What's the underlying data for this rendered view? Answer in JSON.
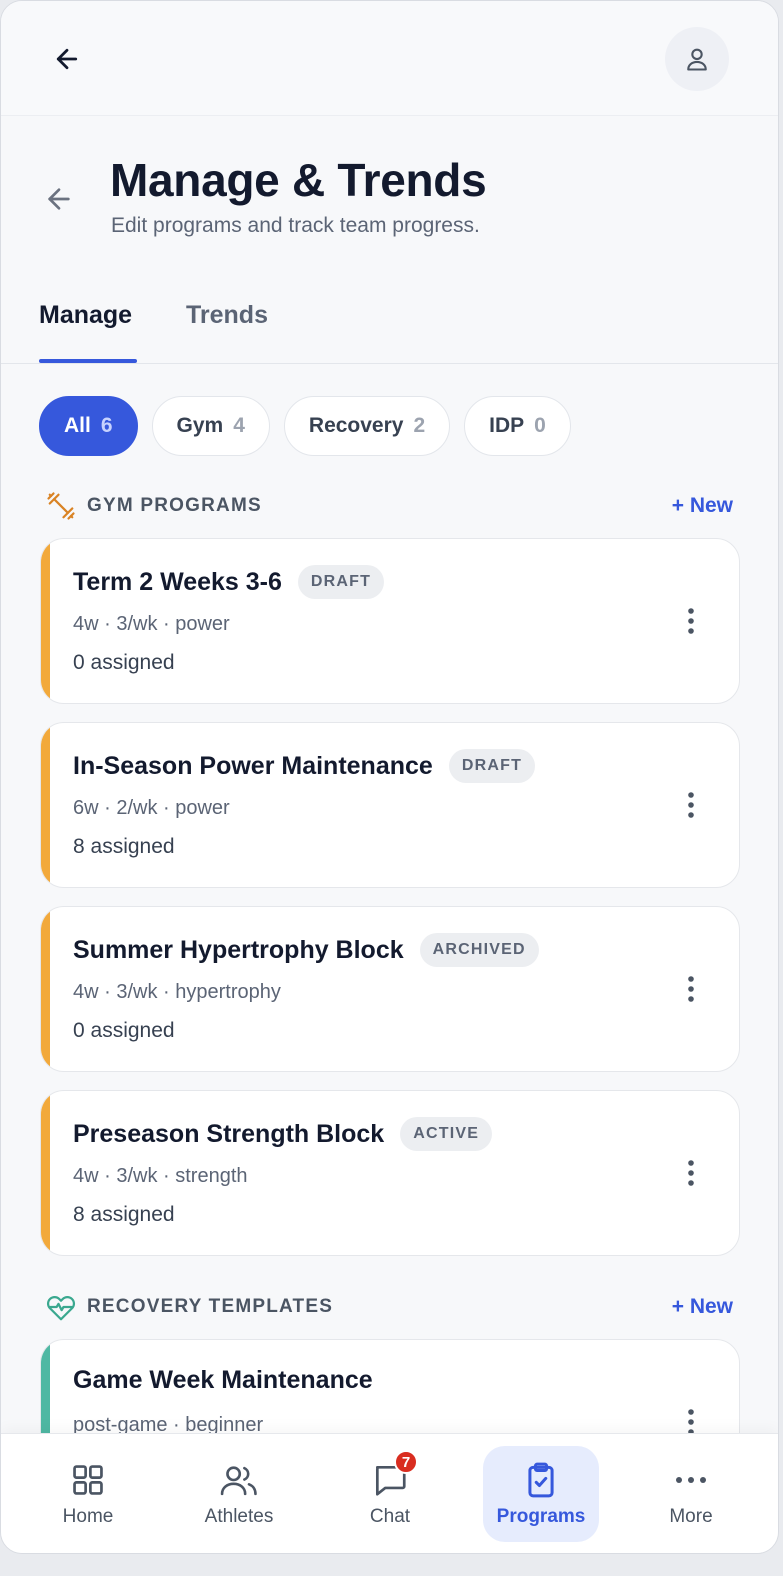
{
  "header": {
    "title": "Manage & Trends",
    "subtitle": "Edit programs and track team progress."
  },
  "tabs": [
    {
      "label": "Manage",
      "active": true
    },
    {
      "label": "Trends",
      "active": false
    }
  ],
  "filters": [
    {
      "label": "All",
      "count": "6",
      "active": true
    },
    {
      "label": "Gym",
      "count": "4",
      "active": false
    },
    {
      "label": "Recovery",
      "count": "2",
      "active": false
    },
    {
      "label": "IDP",
      "count": "0",
      "active": false
    }
  ],
  "gym_section": {
    "title": "GYM PROGRAMS",
    "new_label": "+ New",
    "icon": "dumbbell-icon",
    "accent_color": "#f2a93b",
    "programs": [
      {
        "title": "Term 2 Weeks 3-6",
        "badge": "DRAFT",
        "meta": "4w · 3/wk · power",
        "assigned": "0 assigned"
      },
      {
        "title": "In-Season Power Maintenance",
        "badge": "DRAFT",
        "meta": "6w · 2/wk · power",
        "assigned": "8 assigned"
      },
      {
        "title": "Summer Hypertrophy Block",
        "badge": "ARCHIVED",
        "meta": "4w · 3/wk · hypertrophy",
        "assigned": "0 assigned"
      },
      {
        "title": "Preseason Strength Block",
        "badge": "ACTIVE",
        "meta": "4w · 3/wk · strength",
        "assigned": "8 assigned"
      }
    ]
  },
  "recovery_section": {
    "title": "RECOVERY TEMPLATES",
    "new_label": "+ New",
    "icon": "heart-pulse-icon",
    "accent_color": "#4fb8a3",
    "templates": [
      {
        "title": "Game Week Maintenance",
        "meta": "post-game · beginner"
      }
    ]
  },
  "bottom_nav": [
    {
      "label": "Home",
      "icon": "grid-icon",
      "active": false
    },
    {
      "label": "Athletes",
      "icon": "users-icon",
      "active": false
    },
    {
      "label": "Chat",
      "icon": "chat-icon",
      "badge": "7",
      "active": false
    },
    {
      "label": "Programs",
      "icon": "clipboard-check-icon",
      "active": true
    },
    {
      "label": "More",
      "icon": "more-icon",
      "active": false
    }
  ],
  "colors": {
    "primary": "#3658dc",
    "title": "#131a2e",
    "muted": "#5b6475",
    "badge_red": "#d92d20"
  }
}
